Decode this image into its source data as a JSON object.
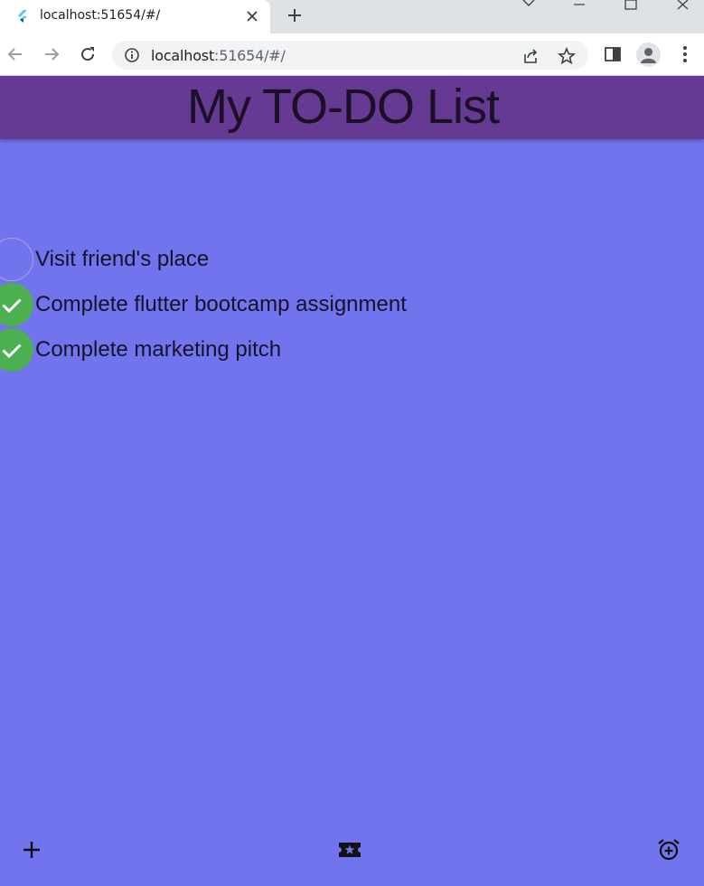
{
  "browser": {
    "tab_title": "localhost:51654/#/",
    "url_host": "localhost",
    "url_rest": ":51654/#/"
  },
  "app": {
    "title": "My TO-DO List",
    "background_color": "#7174ec",
    "appbar_color": "#663a93",
    "check_color": "#4caf50"
  },
  "todos": [
    {
      "text": "Visit friend's place",
      "done": false
    },
    {
      "text": "Complete flutter bootcamp assignment",
      "done": true
    },
    {
      "text": "Complete marketing pitch",
      "done": true
    }
  ],
  "bottom_bar": {
    "left_icon": "add-icon",
    "center_icon": "ticket-star-icon",
    "right_icon": "alarm-add-icon"
  }
}
